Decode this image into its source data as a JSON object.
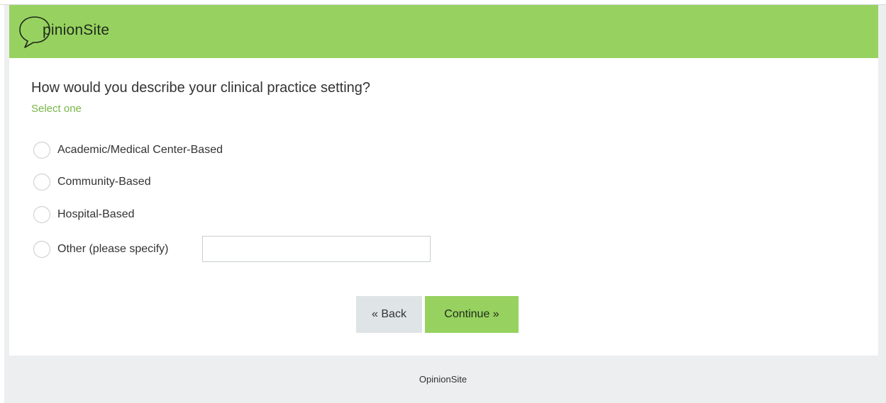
{
  "header": {
    "logo_text": "pinionSite",
    "logo_icon": "speech-bubble-o-icon",
    "background_color": "#97d260"
  },
  "question": {
    "text": "How would you describe your clinical practice setting?",
    "instruction": "Select one"
  },
  "options": [
    {
      "label": "Academic/Medical Center-Based",
      "selected": false
    },
    {
      "label": "Community-Based",
      "selected": false
    },
    {
      "label": "Hospital-Based",
      "selected": false
    },
    {
      "label": "Other (please specify)",
      "selected": false
    }
  ],
  "other_input": {
    "value": "",
    "placeholder": ""
  },
  "buttons": {
    "back_label": "« Back",
    "continue_label": "Continue »"
  },
  "footer": {
    "text": "OpinionSite"
  },
  "colors": {
    "accent": "#97d260",
    "instruction": "#78b648",
    "back_button": "#dfe4e6",
    "page_background": "#eceeef"
  }
}
